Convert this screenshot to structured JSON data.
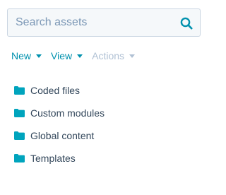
{
  "search": {
    "placeholder": "Search assets",
    "value": "",
    "icon": "search-icon"
  },
  "toolbar": {
    "new_label": "New",
    "view_label": "View",
    "actions_label": "Actions",
    "actions_disabled": true
  },
  "folders": [
    {
      "label": "Coded files",
      "icon": "folder-icon"
    },
    {
      "label": "Custom modules",
      "icon": "folder-icon"
    },
    {
      "label": "Global content",
      "icon": "folder-icon"
    },
    {
      "label": "Templates",
      "icon": "folder-icon"
    }
  ],
  "colors": {
    "accent": "#0091ae",
    "folder": "#00a4bd",
    "text": "#33475b",
    "placeholder": "#7c98b6",
    "disabled": "#b0c1d4",
    "input_border": "#cbd6e2",
    "input_bg": "#f5f8fa"
  }
}
